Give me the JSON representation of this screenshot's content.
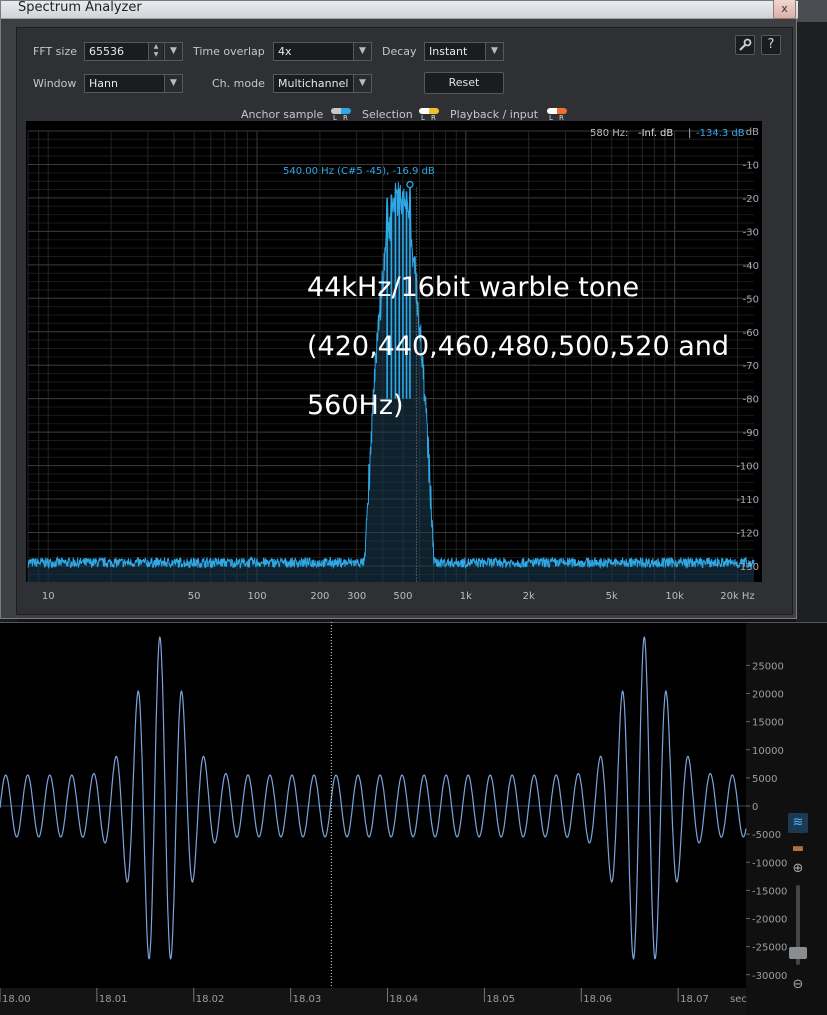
{
  "window": {
    "title": "Spectrum Analyzer",
    "close_glyph": "x"
  },
  "controls": {
    "fft_size_label": "FFT size",
    "fft_size_value": "65536",
    "time_overlap_label": "Time overlap",
    "time_overlap_value": "4x",
    "decay_label": "Decay",
    "decay_value": "Instant",
    "window_label": "Window",
    "window_value": "Hann",
    "ch_mode_label": "Ch. mode",
    "ch_mode_value": "Multichannel",
    "reset_label": "Reset",
    "settings_icon": "wrench-icon",
    "help_label": "?"
  },
  "legend": {
    "anchor_label": "Anchor sample",
    "selection_label": "Selection",
    "playback_label": "Playback / input",
    "l": "L",
    "r": "R",
    "anchor_colors": [
      "#c8c8c8",
      "#2fa8e6"
    ],
    "selection_colors": [
      "#ffffff",
      "#f0c030"
    ],
    "playback_colors": [
      "#ffffff",
      "#f07030"
    ]
  },
  "readout": {
    "cursor_freq": "580 Hz:",
    "cursor_val_left": "-Inf. dB",
    "separator": "|",
    "cursor_val_right": "-134.3 dB",
    "peak_label": "540.00 Hz (C#5 -45), -16.9 dB"
  },
  "annotation": {
    "line1": "44kHz/16bit  warble tone",
    "line2": "(420,440,460,480,500,520 and",
    "line3": "560Hz)"
  },
  "chart_data": [
    {
      "type": "line",
      "title": "",
      "xlabel": "",
      "ylabel": "dB",
      "x_scale": "log",
      "xlim": [
        8,
        24000
      ],
      "ylim": [
        -133,
        0
      ],
      "x_ticks": [
        "10",
        "50",
        "100",
        "200",
        "300",
        "500",
        "1k",
        "2k",
        "5k",
        "10k",
        "20k Hz"
      ],
      "y_ticks": [
        "dB",
        "-10",
        "-20",
        "-30",
        "-40",
        "-50",
        "-60",
        "-70",
        "-80",
        "-90",
        "-100",
        "-110",
        "-120",
        "-130"
      ],
      "grid": true,
      "line_color": "#2fa8e6",
      "noise_floor_db": -129,
      "peaks": [
        {
          "x": 420,
          "y": -20
        },
        {
          "x": 440,
          "y": -19
        },
        {
          "x": 460,
          "y": -18
        },
        {
          "x": 480,
          "y": -19
        },
        {
          "x": 500,
          "y": -18
        },
        {
          "x": 520,
          "y": -18
        },
        {
          "x": 540,
          "y": -17
        }
      ],
      "marker": {
        "x": 540,
        "y": -16.9
      }
    },
    {
      "type": "line",
      "title": "",
      "xlabel": "sec",
      "ylabel": "",
      "xlim": [
        18.0,
        18.077
      ],
      "ylim": [
        -32000,
        32000
      ],
      "x_ticks": [
        "18.00",
        "18.01",
        "18.02",
        "18.03",
        "18.04",
        "18.05",
        "18.06",
        "18.07",
        "sec"
      ],
      "x_tick_values": [
        18.0,
        18.01,
        18.02,
        18.03,
        18.04,
        18.05,
        18.06,
        18.07
      ],
      "y_ticks": [
        "25000",
        "20000",
        "15000",
        "10000",
        "5000",
        "0",
        "-5000",
        "-10000",
        "-15000",
        "-20000",
        "-25000",
        "-30000"
      ],
      "y_tick_values": [
        25000,
        20000,
        15000,
        10000,
        5000,
        0,
        -5000,
        -10000,
        -15000,
        -20000,
        -25000,
        -30000
      ],
      "cursor_x": 18.0342,
      "line_color": "#7aa4dc",
      "carrier_hz": 440,
      "burst_centers": [
        18.0165,
        18.0665
      ],
      "burst_peak": 30000,
      "baseline_amplitude": 5500
    }
  ]
}
